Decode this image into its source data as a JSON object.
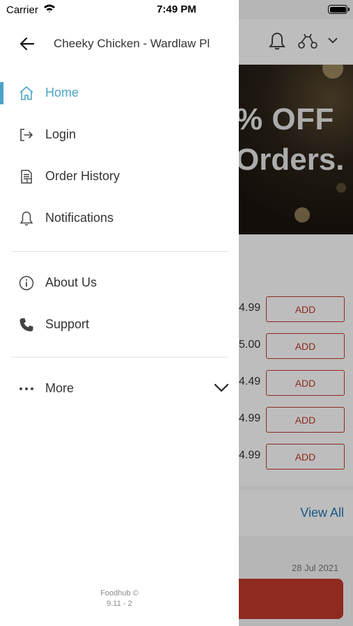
{
  "status_bar": {
    "carrier": "Carrier",
    "time": "7:49 PM"
  },
  "drawer": {
    "store_name": "Cheeky Chicken - Wardlaw Pl",
    "menu": [
      {
        "label": "Home",
        "icon": "home-icon",
        "active": true
      },
      {
        "label": "Login",
        "icon": "login-icon",
        "active": false
      },
      {
        "label": "Order History",
        "icon": "receipt-icon",
        "active": false
      },
      {
        "label": "Notifications",
        "icon": "bell-icon",
        "active": false
      }
    ],
    "secondary_menu": [
      {
        "label": "About Us",
        "icon": "info-icon"
      },
      {
        "label": "Support",
        "icon": "phone-icon"
      }
    ],
    "more_label": "More",
    "footer": {
      "brand": "Foodhub ©",
      "version": "9.11 - 2"
    }
  },
  "background": {
    "banner": {
      "line1": "% OFF",
      "line2": "Orders."
    },
    "items": [
      {
        "price": "4.99",
        "button": "ADD"
      },
      {
        "price": "5.00",
        "button": "ADD"
      },
      {
        "price": "4.49",
        "button": "ADD"
      },
      {
        "price": "4.99",
        "button": "ADD"
      },
      {
        "price": "4.99",
        "button": "ADD"
      }
    ],
    "view_all": "View All",
    "date": "28 Jul 2021"
  },
  "colors": {
    "accent": "#4aa3c7",
    "brand_red": "#c0392b",
    "link": "#1f78b4"
  }
}
